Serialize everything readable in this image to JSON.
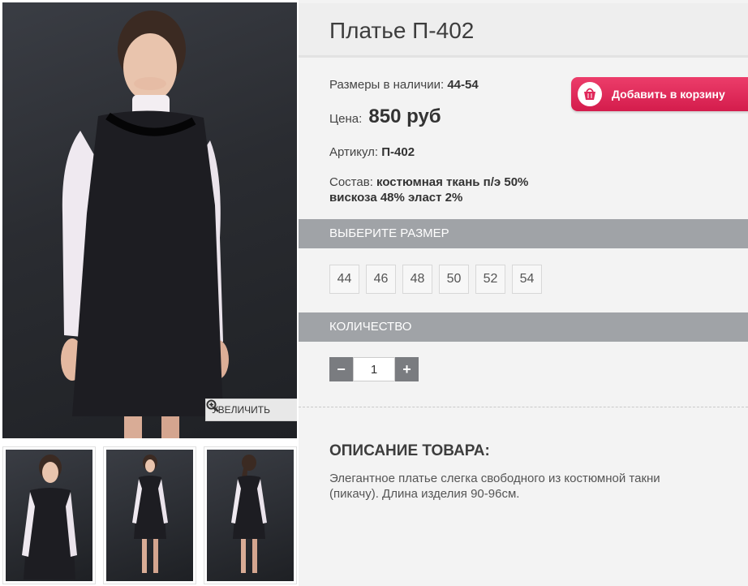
{
  "product": {
    "title": "Платье П-402",
    "sizes_label": "Размеры в наличии:",
    "sizes_value": "44-54",
    "price_label": "Цена:",
    "price_value": "850 руб",
    "article_label": "Артикул:",
    "article_value": "П-402",
    "composition_label": "Состав:",
    "composition_value_line1": "костюмная ткань п/э 50%",
    "composition_value_line2": "вискоза 48% эласт 2%"
  },
  "cart": {
    "label": "Добавить в корзину",
    "icon": "basket-icon",
    "color": "#e0285a"
  },
  "gallery": {
    "zoom_label": "УВЕЛИЧИТЬ",
    "zoom_icon": "magnifier-plus-icon"
  },
  "size_section": {
    "heading": "ВЫБЕРИТЕ РАЗМЕР",
    "sizes": [
      "44",
      "46",
      "48",
      "50",
      "52",
      "54"
    ]
  },
  "quantity_section": {
    "heading": "КОЛИЧЕСТВО",
    "minus": "−",
    "plus": "+",
    "value": "1"
  },
  "description": {
    "title": "ОПИСАНИЕ ТОВАРА:",
    "text": "Элегантное платье слегка свободного из костюмной такни (пикачу). Длина изделия 90-96см."
  },
  "colors": {
    "section_bar": "#a0a3a7",
    "accent": "#e0285a",
    "panel_bg": "#f3f3f3"
  }
}
